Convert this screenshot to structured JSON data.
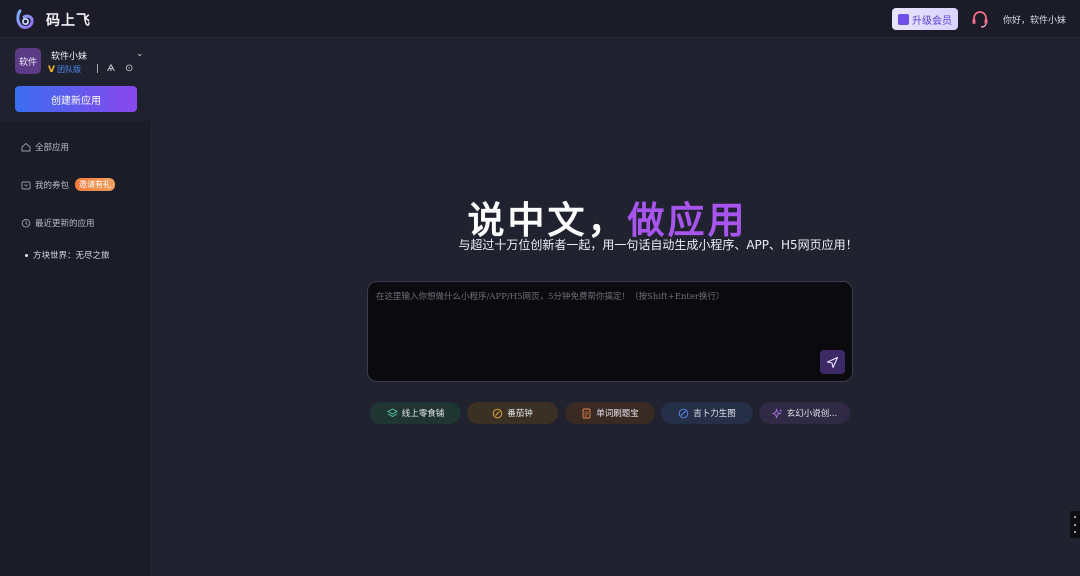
{
  "header": {
    "app_name": "码上飞",
    "upgrade_label": "升级会员",
    "greeting": "你好，软件小妹"
  },
  "sidebar": {
    "team": {
      "avatar_text": "软件",
      "name": "软件小妹",
      "edition": "团队版",
      "separator": "|"
    },
    "create_button": "创建新应用",
    "nav": {
      "all_apps": "全部应用",
      "my_coupons": "我的券包",
      "invite_badge": "邀请有礼",
      "recent": "最近更新的应用"
    },
    "recent_items": [
      "方块世界：无尽之旅"
    ]
  },
  "main": {
    "title_white": "说中文，",
    "title_purple": "做应用",
    "subtitle": "与超过十万位创新者一起，用一句话自动生成小程序、APP、H5网页应用！",
    "prompt_placeholder": "在这里输入你想做什么小程序/APP/H5网页，5分钟免费帮你搞定！（按Shift+Enter换行）",
    "chips": [
      {
        "label": "线上零食铺",
        "icon": "layers-icon",
        "bg": "#1e3531",
        "color": "#56c9a4"
      },
      {
        "label": "番茄钟",
        "icon": "clock-icon",
        "bg": "#3a3124",
        "color": "#f0b23a"
      },
      {
        "label": "单词刷题宝",
        "icon": "document-icon",
        "bg": "#3a2a24",
        "color": "#f08a4a"
      },
      {
        "label": "吉卜力生图",
        "icon": "image-icon",
        "bg": "#252f47",
        "color": "#5f8cf0"
      },
      {
        "label": "玄幻小说创...",
        "icon": "sparkle-icon",
        "bg": "#302a45",
        "color": "#b27af0"
      }
    ]
  },
  "colors": {
    "accent_purple": "#a855f0",
    "create_gradient_start": "#3b6ef0",
    "create_gradient_end": "#8a48ec"
  }
}
